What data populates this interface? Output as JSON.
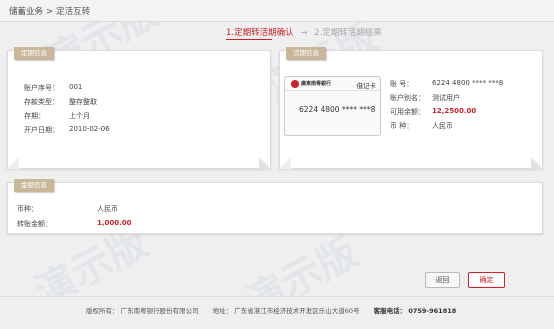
{
  "breadcrumb": {
    "root": "储蓄业务",
    "sep": ">",
    "current": "定活互转"
  },
  "steps": {
    "step1": "1.定期转活期确认",
    "arrow": "→",
    "step2": "2.定期转活期结果"
  },
  "fixed_panel": {
    "title": "定期信息",
    "rows": [
      {
        "label": "账户序号：",
        "value": "001"
      },
      {
        "label": "存款类型：",
        "value": "整存整取"
      },
      {
        "label": "存期：",
        "value": "上个月"
      },
      {
        "label": "开户日期：",
        "value": "2010-02-06"
      }
    ]
  },
  "current_panel": {
    "title": "活期信息",
    "card": {
      "bank": "廣東南粵銀行",
      "type": "借记卡",
      "number": "6224 4800 **** ***8"
    },
    "rows": [
      {
        "label": "账    号：",
        "value": "6224 4800 **** ***8"
      },
      {
        "label": "账户别名：",
        "value": "测试用户"
      },
      {
        "label": "可用余额：",
        "value": "12,2500.00"
      },
      {
        "label": "币    种：",
        "value": "人民币"
      }
    ]
  },
  "amount_panel": {
    "title": "金额信息",
    "rows": [
      {
        "label": "币种：",
        "value": "人民币"
      },
      {
        "label": "转账金额：",
        "value": "1,000.00"
      }
    ]
  },
  "buttons": {
    "back": "返回",
    "confirm": "确定"
  },
  "footer": {
    "copyright": "版权所有：  广东南粤银行股份有限公司",
    "address": "地址：  广东省湛江市经济技术开发区乐山大道60号",
    "hotline": "客服电话：  0759-961818"
  },
  "watermark": "演示版",
  "colors": {
    "accent": "#c8242c",
    "tag": "#c8b79a"
  }
}
